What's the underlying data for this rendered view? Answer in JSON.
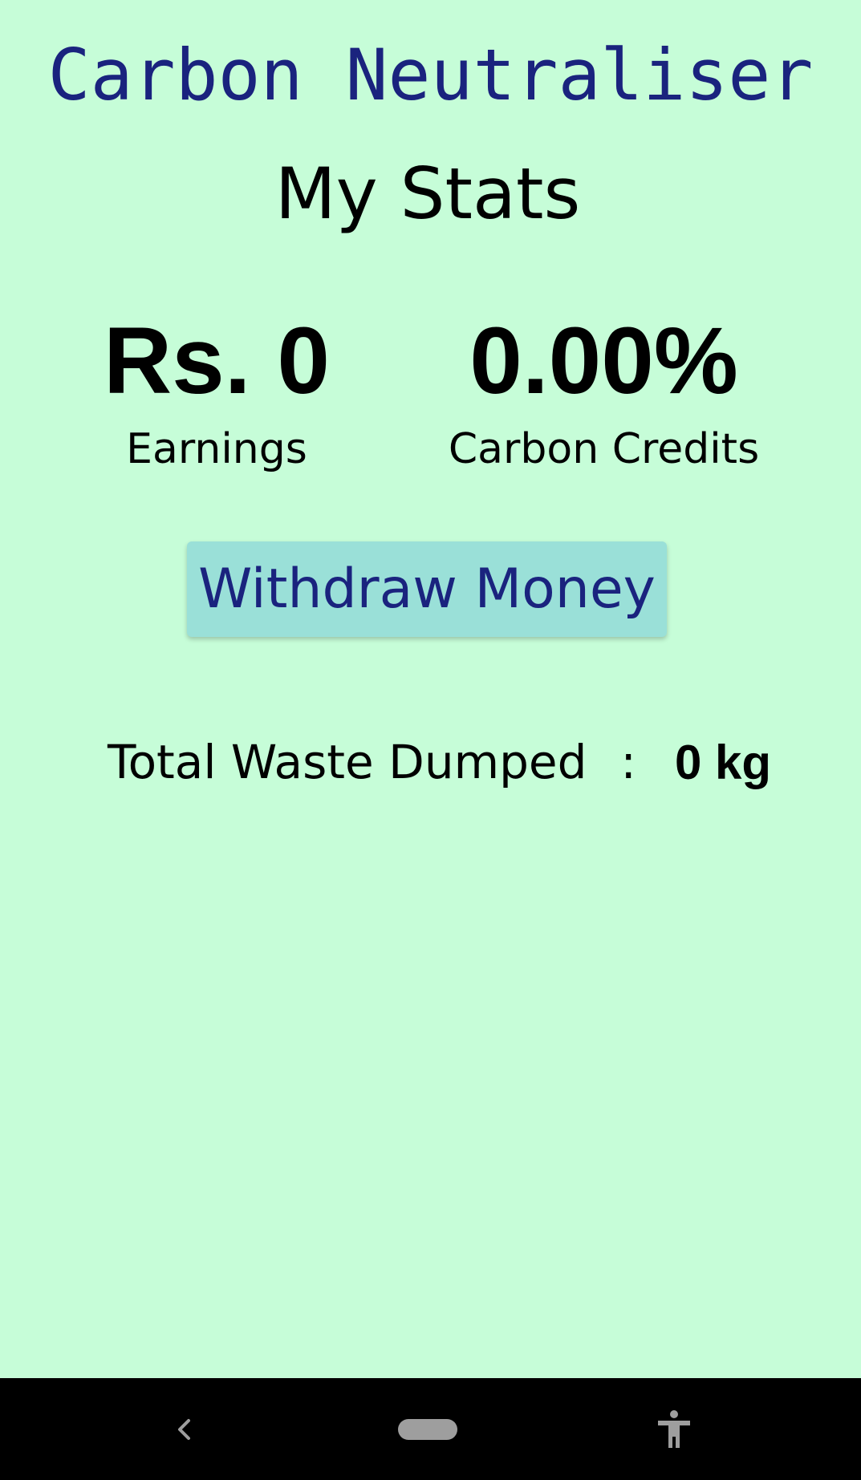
{
  "app": {
    "title": "Carbon Neutraliser"
  },
  "page": {
    "title": "My Stats"
  },
  "stats": {
    "earnings": {
      "value": "Rs. 0",
      "label": "Earnings"
    },
    "carbon_credits": {
      "value": "0.00%",
      "label": "Carbon Credits"
    }
  },
  "withdraw": {
    "label": "Withdraw Money"
  },
  "waste": {
    "label": "Total Waste Dumped",
    "separator": ":",
    "value": "0 kg"
  },
  "nav": {
    "icons": [
      "back-icon",
      "home-pill-icon",
      "accessibility-icon"
    ]
  },
  "colors": {
    "background": "#c6fdd8",
    "accent_text": "#1a237e",
    "button_bg": "#9ae0d8",
    "navbar": "#000000",
    "nav_icon": "#9e9e9e"
  }
}
